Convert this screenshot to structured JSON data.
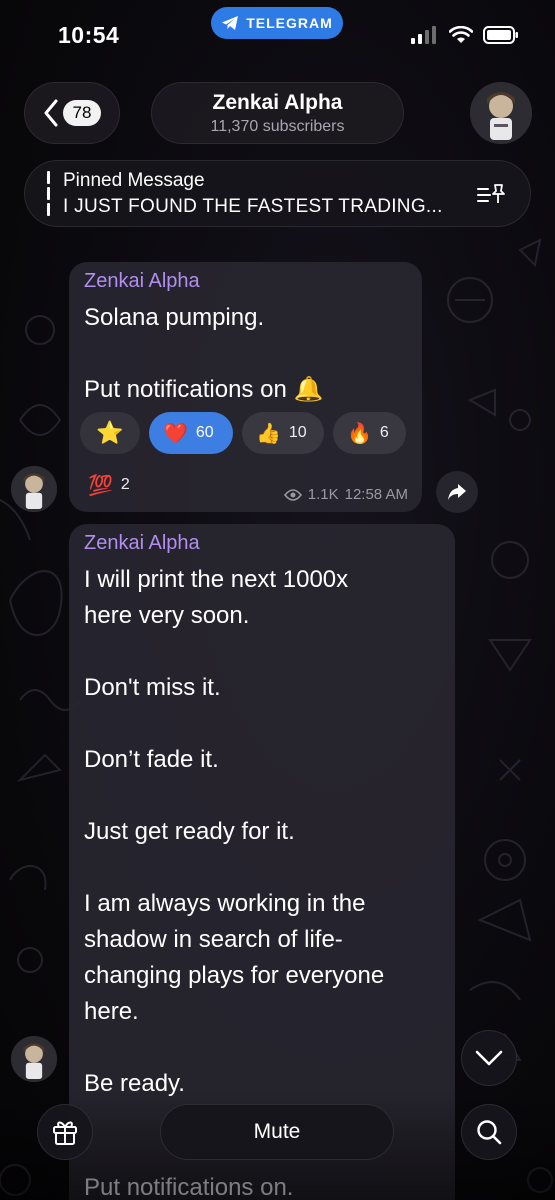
{
  "status_bar": {
    "time": "10:54",
    "app_pill": "TELEGRAM"
  },
  "header": {
    "back_count": "78",
    "title": "Zenkai Alpha",
    "subscribers": "11,370 subscribers"
  },
  "pinned": {
    "label": "Pinned Message",
    "text": "I JUST FOUND THE FASTEST TRADING..."
  },
  "messages": [
    {
      "sender": "Zenkai Alpha",
      "text": "Solana pumping.\n\nPut notifications on 🔔",
      "reactions": [
        {
          "emoji": "⭐",
          "count": ""
        },
        {
          "emoji": "❤️",
          "count": "60",
          "active": true
        },
        {
          "emoji": "👍",
          "count": "10"
        },
        {
          "emoji": "🔥",
          "count": "6"
        },
        {
          "emoji": "💯",
          "count": "2"
        }
      ],
      "views": "1.1K",
      "time": "12:58 AM"
    },
    {
      "sender": "Zenkai Alpha",
      "text": "I will print the next 1000x\nhere very soon.\n\nDon't miss it.\n\nDon’t fade it.\n\nJust get ready for it.\n\nI am always working in the\nshadow in search of life-\nchanging plays for everyone\nhere.\n\nBe ready.",
      "trailing": "Put notifications on."
    }
  ],
  "bottom": {
    "mute_label": "Mute"
  },
  "icons": {
    "back": "chevron-left-icon",
    "pin": "pin-list-icon",
    "forward": "share-arrow-icon",
    "scroll_down": "chevron-down-icon",
    "gift": "gift-icon",
    "search": "search-icon",
    "views": "eye-icon"
  },
  "colors": {
    "accent": "#3d7ee2",
    "sender": "#b18ef0",
    "telegram_pill": "#2f7be6"
  }
}
